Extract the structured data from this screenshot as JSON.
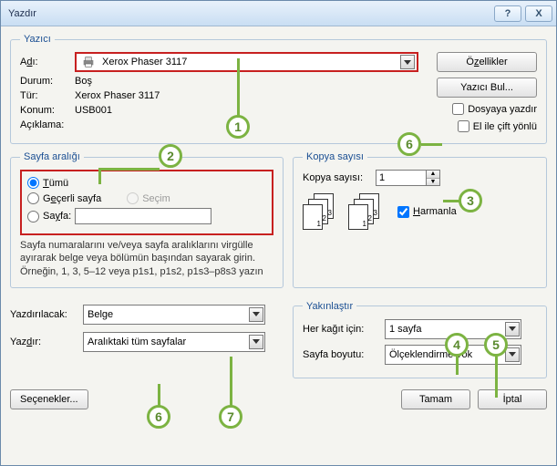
{
  "window": {
    "title": "Yazdır",
    "help": "?",
    "close": "X"
  },
  "printer": {
    "legend": "Yazıcı",
    "name_label_pre": "A",
    "name_label_und": "d",
    "name_label_post": "ı:",
    "name_value": "Xerox Phaser 3117",
    "status_label": "Durum:",
    "status_value": "Boş",
    "type_label": "Tür:",
    "type_value": "Xerox Phaser 3117",
    "loc_label": "Konum:",
    "loc_value": "USB001",
    "comment_label": "Açıklama:",
    "props_pre": "Ö",
    "props_und": "z",
    "props_post": "ellikler",
    "findprinter": "Yazıcı Bul...",
    "printtofile": "Dosyaya yazdır",
    "manualduplex": "El ile çift yönlü"
  },
  "range": {
    "legend": "Sayfa aralığı",
    "all_und": "T",
    "all_rest": "ümü",
    "current_pre": "G",
    "current_und": "e",
    "current_post": "çerli sayfa",
    "selection": "Seçim",
    "pages_pre": "Sa",
    "pages_und": "y",
    "pages_post": "fa:",
    "pages_value": "",
    "help": "Sayfa numaralarını ve/veya sayfa aralıklarını virgülle ayırarak belge veya bölümün başından sayarak girin. Örneğin, 1, 3, 5–12 veya p1s1, p1s2, p1s3–p8s3 yazın"
  },
  "copies": {
    "legend": "Kopya sayısı",
    "count_label": "Kopya sayısı:",
    "count_value": "1",
    "collate_und": "H",
    "collate_rest": "armanla"
  },
  "whatprint": {
    "what_label": "Yazdırılacak:",
    "what_value": "Belge",
    "print_label_pre": "Yaz",
    "print_label_und": "d",
    "print_label_post": "ır:",
    "print_value": "Aralıktaki tüm sayfalar"
  },
  "zoom": {
    "legend": "Yakınlaştır",
    "persheet_label": "Her kağıt için:",
    "persheet_value": "1 sayfa",
    "scale_label": "Sayfa boyutu:",
    "scale_value": "Ölçeklendirme Yok"
  },
  "footer": {
    "options": "Seçenekler...",
    "ok": "Tamam",
    "cancel": "İptal"
  },
  "annotations": {
    "a1": "1",
    "a2": "2",
    "a3": "3",
    "a4": "4",
    "a5": "5",
    "a6": "6",
    "a67": "6",
    "a7": "7"
  }
}
